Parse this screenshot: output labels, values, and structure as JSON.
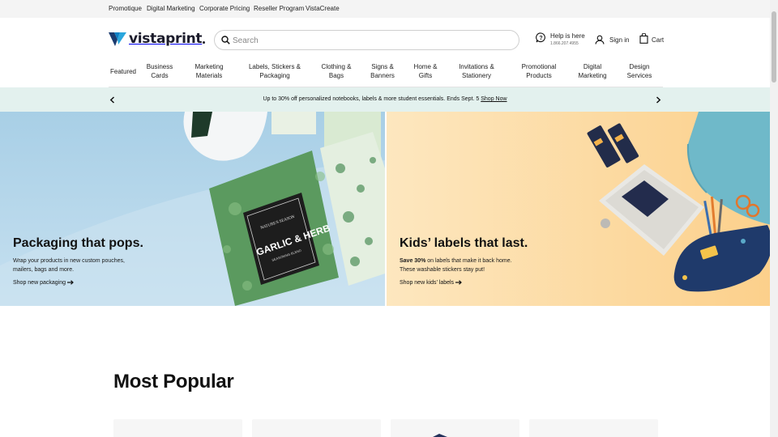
{
  "topbar": {
    "links": [
      {
        "label": "Promotique"
      },
      {
        "label": "Digital Marketing"
      },
      {
        "label": "Corporate Pricing"
      },
      {
        "label": "Reseller Program"
      },
      {
        "label": "VistaCreate"
      }
    ]
  },
  "header": {
    "logo_text": "vistaprint",
    "logo_icon": "vistaprint-v-logo",
    "search": {
      "placeholder": "Search",
      "icon": "search-icon"
    },
    "help": {
      "title": "Help is here",
      "phone": "1.866.207.4955",
      "icon": "chat-help-icon"
    },
    "signin": {
      "label": "Sign in",
      "icon": "user-icon"
    },
    "cart": {
      "label": "Cart",
      "icon": "shopping-bag-icon"
    }
  },
  "nav": {
    "items": [
      {
        "label": "Featured"
      },
      {
        "label_line1": "Business",
        "label_line2": "Cards"
      },
      {
        "label_line1": "Marketing",
        "label_line2": "Materials"
      },
      {
        "label_line1": "Labels, Stickers &",
        "label_line2": "Packaging"
      },
      {
        "label_line1": "Clothing &",
        "label_line2": "Bags"
      },
      {
        "label_line1": "Signs &",
        "label_line2": "Banners"
      },
      {
        "label_line1": "Home &",
        "label_line2": "Gifts"
      },
      {
        "label_line1": "Invitations &",
        "label_line2": "Stationery"
      },
      {
        "label_line1": "Promotional",
        "label_line2": "Products"
      },
      {
        "label_line1": "Digital",
        "label_line2": "Marketing"
      },
      {
        "label_line1": "Design",
        "label_line2": "Services"
      }
    ]
  },
  "promo": {
    "text": "Up to 30% off personalized notebooks, labels & more student essentials. Ends Sept. 5",
    "link": "Shop Now",
    "prev_icon": "chevron-left-icon",
    "next_icon": "chevron-right-icon"
  },
  "heroes": [
    {
      "title": "Packaging that pops.",
      "body_line1": "Wrap your products in new custom pouches,",
      "body_line2": "mailers, bags and more.",
      "cta": "Shop new packaging",
      "cta_icon": "arrow-right-icon",
      "product_label_line1": "NATURE'S SEASON",
      "product_label_line2": "GARLIC & HERB",
      "product_label_line3": "SEASONING BLEND"
    },
    {
      "title": "Kids’ labels that last.",
      "body_bold": "Save 30%",
      "body_line1": " on labels that make it back home.",
      "body_line2": "These washable stickers stay put!",
      "cta": "Shop new kids’ labels",
      "cta_icon": "arrow-right-icon"
    }
  ],
  "most_popular": {
    "title": "Most Popular"
  },
  "colors": {
    "promo_bg": "#e3f1ee",
    "hero_left_bg": "#b5d8ec",
    "hero_right_bg": "#fcd9a0",
    "logo_blue": "#0e7fc4",
    "logo_navy": "#1b1b2b"
  }
}
